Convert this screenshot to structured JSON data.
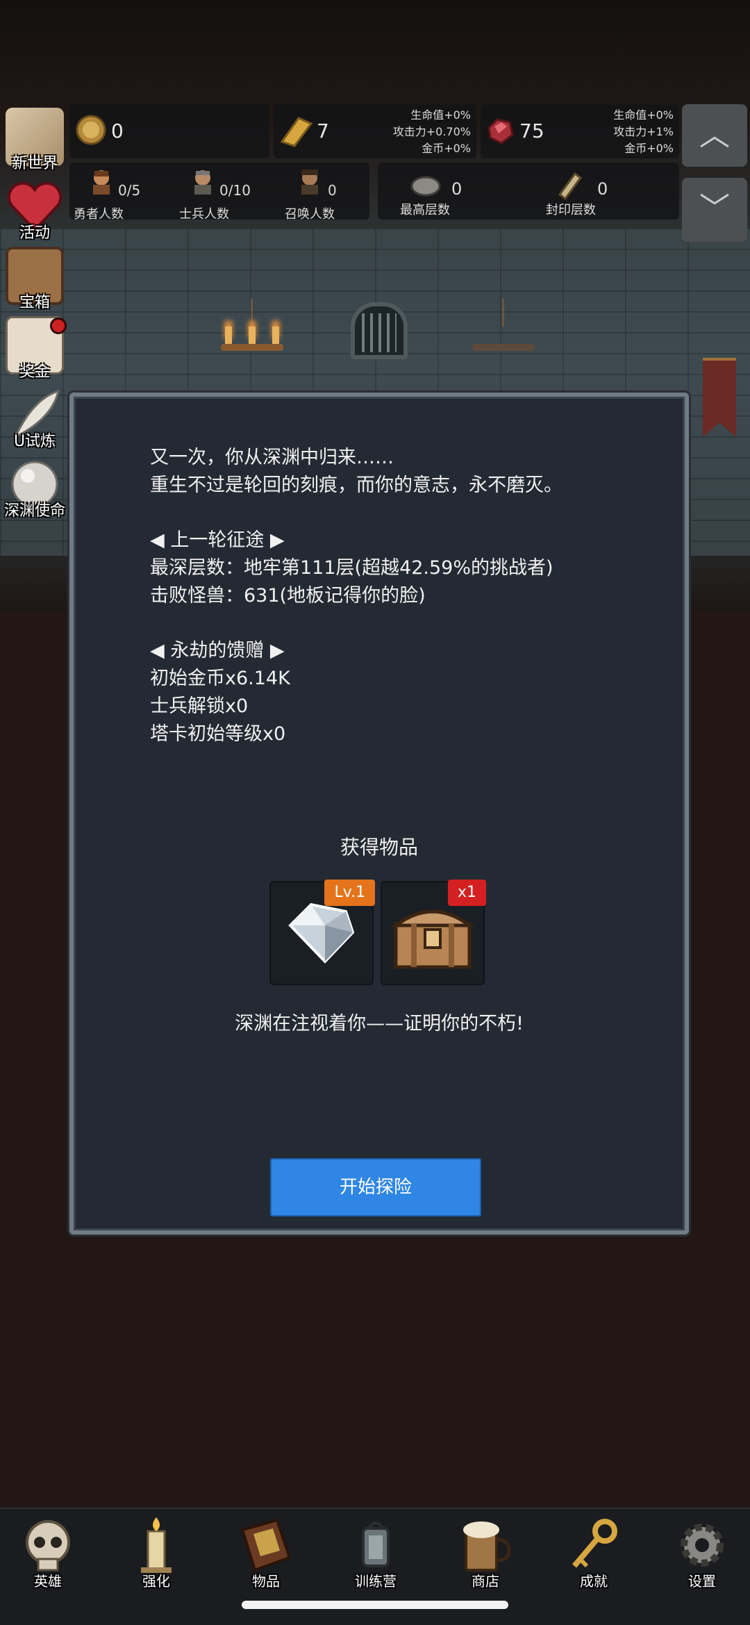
{
  "side_menu": [
    {
      "label": "新世界",
      "icon": "map-icon"
    },
    {
      "label": "活动",
      "icon": "heart-icon"
    },
    {
      "label": "宝箱",
      "icon": "chest-icon"
    },
    {
      "label": "奖金",
      "icon": "envelope-icon"
    },
    {
      "label": "U试炼",
      "icon": "feather-icon"
    },
    {
      "label": "深渊使命",
      "icon": "pearl-icon"
    }
  ],
  "resources": {
    "gold": "0",
    "gold_bar": "7",
    "gold_bar_bonus": [
      "生命值+0%",
      "攻击力+0.70%",
      "金币+0%"
    ],
    "ruby": "75",
    "ruby_bonus": [
      "生命值+0%",
      "攻击力+1%",
      "金币+0%"
    ]
  },
  "counts": {
    "heroes": {
      "value": "0/5",
      "label": "勇者人数"
    },
    "soldiers": {
      "value": "0/10",
      "label": "士兵人数"
    },
    "summons": {
      "value": "0",
      "label": "召唤人数"
    },
    "max_floor": {
      "value": "0",
      "label": "最高层数"
    },
    "sealed_floor": {
      "value": "0",
      "label": "封印层数"
    }
  },
  "dialog": {
    "lines": [
      "又一次，你从深渊中归来……",
      "重生不过是轮回的刻痕，而你的意志，永不磨灭。",
      "",
      "◀ 上一轮征途 ▶",
      "最深层数：地牢第111层(超越42.59%的挑战者)",
      "击败怪兽：631(地板记得你的脸)",
      "",
      "◀ 永劫的馈赠 ▶",
      "初始金币x6.14K",
      "士兵解锁x0",
      "塔卡初始等级x0"
    ],
    "rewards_title": "获得物品",
    "items": [
      {
        "icon": "diamond-icon",
        "tag": "Lv.1",
        "tag_color": "#e3741c"
      },
      {
        "icon": "treasure-chest-icon",
        "tag": "x1",
        "tag_color": "#d42020"
      }
    ],
    "tagline": "深渊在注视着你——证明你的不朽!",
    "start_button": "开始探险"
  },
  "bottom_nav": [
    {
      "label": "英雄",
      "icon": "skull-icon"
    },
    {
      "label": "强化",
      "icon": "candle-icon"
    },
    {
      "label": "物品",
      "icon": "book-icon"
    },
    {
      "label": "训练营",
      "icon": "lantern-icon"
    },
    {
      "label": "商店",
      "icon": "mug-icon"
    },
    {
      "label": "成就",
      "icon": "key-icon"
    },
    {
      "label": "设置",
      "icon": "gear-icon"
    }
  ]
}
